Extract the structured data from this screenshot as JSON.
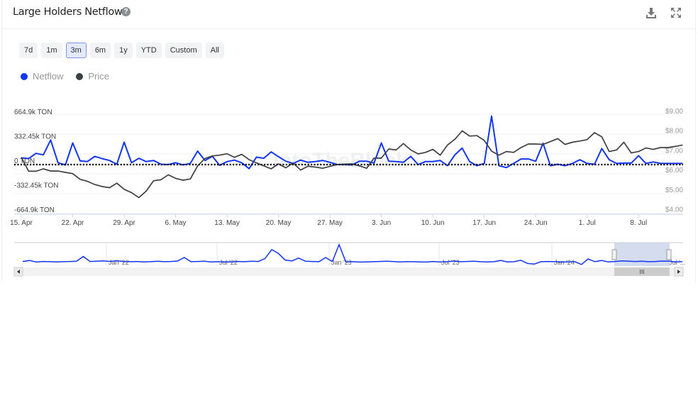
{
  "header": {
    "title": "Large Holders Netflow",
    "help_icon": "question-circle-icon",
    "download_icon": "download-icon",
    "fullscreen_icon": "expand-icon"
  },
  "ranges": [
    {
      "label": "7d"
    },
    {
      "label": "1m"
    },
    {
      "label": "3m",
      "selected": true
    },
    {
      "label": "6m"
    },
    {
      "label": "1y"
    },
    {
      "label": "YTD"
    },
    {
      "label": "Custom"
    },
    {
      "label": "All"
    }
  ],
  "legend": [
    {
      "label": "Netflow",
      "color": "#1336f2"
    },
    {
      "label": "Price",
      "color": "#3d3f42"
    }
  ],
  "watermark": "IntoTheBlock",
  "chart_data": {
    "type": "line",
    "title": "",
    "y_left": {
      "ticks": [
        "664.9k TON",
        "332.45k TON",
        "0 TON",
        "-332.45k TON",
        "-664.9k TON"
      ],
      "range": [
        -664.9,
        664.9
      ],
      "unit": "k TON"
    },
    "y_right": {
      "ticks": [
        "$9.00",
        "$8.00",
        "$7.00",
        "$6.00",
        "$5.00",
        "$4.00"
      ],
      "range": [
        4,
        9
      ]
    },
    "x_ticks": [
      "15. Apr",
      "22. Apr",
      "29. Apr",
      "6. May",
      "13. May",
      "20. May",
      "27. May",
      "3. Jun",
      "10. Jun",
      "17. Jun",
      "24. Jun",
      "1. Jul",
      "8. Jul"
    ],
    "dates": [
      "2024-04-15",
      "2024-04-16",
      "2024-04-17",
      "2024-04-18",
      "2024-04-19",
      "2024-04-20",
      "2024-04-21",
      "2024-04-22",
      "2024-04-23",
      "2024-04-24",
      "2024-04-25",
      "2024-04-26",
      "2024-04-27",
      "2024-04-28",
      "2024-04-29",
      "2024-04-30",
      "2024-05-01",
      "2024-05-02",
      "2024-05-03",
      "2024-05-04",
      "2024-05-05",
      "2024-05-06",
      "2024-05-07",
      "2024-05-08",
      "2024-05-09",
      "2024-05-10",
      "2024-05-11",
      "2024-05-12",
      "2024-05-13",
      "2024-05-14",
      "2024-05-15",
      "2024-05-16",
      "2024-05-17",
      "2024-05-18",
      "2024-05-19",
      "2024-05-20",
      "2024-05-21",
      "2024-05-22",
      "2024-05-23",
      "2024-05-24",
      "2024-05-25",
      "2024-05-26",
      "2024-05-27",
      "2024-05-28",
      "2024-05-29",
      "2024-05-30",
      "2024-05-31",
      "2024-06-01",
      "2024-06-02",
      "2024-06-03",
      "2024-06-04",
      "2024-06-05",
      "2024-06-06",
      "2024-06-07",
      "2024-06-08",
      "2024-06-09",
      "2024-06-10",
      "2024-06-11",
      "2024-06-12",
      "2024-06-13",
      "2024-06-14",
      "2024-06-15",
      "2024-06-16",
      "2024-06-17",
      "2024-06-18",
      "2024-06-19",
      "2024-06-20",
      "2024-06-21",
      "2024-06-22",
      "2024-06-23",
      "2024-06-24",
      "2024-06-25",
      "2024-06-26",
      "2024-06-27",
      "2024-06-28",
      "2024-06-29",
      "2024-06-30",
      "2024-07-01",
      "2024-07-02",
      "2024-07-03",
      "2024-07-04",
      "2024-07-05",
      "2024-07-06",
      "2024-07-07",
      "2024-07-08",
      "2024-07-09",
      "2024-07-10",
      "2024-07-11",
      "2024-07-12",
      "2024-07-13",
      "2024-07-14"
    ],
    "series": [
      {
        "name": "Netflow",
        "axis": "left",
        "color": "#1336f2",
        "values": [
          90,
          80,
          150,
          130,
          330,
          25,
          -5,
          290,
          50,
          40,
          110,
          80,
          55,
          5,
          300,
          25,
          85,
          40,
          55,
          5,
          0,
          25,
          -5,
          15,
          180,
          55,
          110,
          -10,
          40,
          60,
          25,
          -55,
          100,
          85,
          170,
          105,
          45,
          15,
          60,
          30,
          40,
          55,
          30,
          0,
          0,
          -5,
          45,
          45,
          20,
          290,
          45,
          40,
          30,
          110,
          0,
          40,
          40,
          55,
          -15,
          130,
          220,
          40,
          -15,
          15,
          650,
          -15,
          -40,
          15,
          75,
          75,
          45,
          285,
          -15,
          5,
          -15,
          15,
          65,
          15,
          5,
          215,
          65,
          15,
          20,
          20,
          120,
          15,
          35,
          15,
          15,
          15,
          15
        ]
      },
      {
        "name": "Price",
        "axis": "right",
        "color": "#3d3f42",
        "values": [
          6.83,
          6.13,
          6.13,
          6.25,
          6.14,
          6.14,
          6.07,
          6.01,
          5.72,
          5.62,
          5.46,
          5.36,
          5.3,
          5.53,
          5.22,
          5.05,
          4.8,
          5.13,
          5.65,
          5.7,
          5.95,
          5.77,
          5.68,
          5.74,
          6.4,
          6.77,
          6.9,
          6.94,
          7.01,
          6.83,
          6.98,
          6.71,
          6.55,
          6.4,
          6.25,
          6.5,
          6.3,
          6.55,
          6.19,
          6.38,
          6.34,
          6.28,
          6.37,
          6.47,
          6.49,
          6.5,
          6.4,
          6.28,
          6.79,
          6.79,
          7.25,
          7.2,
          7.52,
          7.2,
          7.0,
          7.08,
          7.23,
          6.94,
          7.45,
          7.74,
          8.16,
          7.9,
          7.92,
          7.68,
          7.14,
          6.94,
          7.12,
          7.08,
          7.32,
          7.5,
          7.5,
          7.48,
          7.62,
          7.77,
          7.48,
          7.59,
          7.65,
          7.72,
          8.07,
          7.86,
          7.12,
          7.2,
          7.59,
          7.05,
          7.12,
          7.3,
          7.23,
          7.32,
          7.32,
          7.38,
          7.45
        ]
      }
    ],
    "zero_line": "dotted",
    "legend_position": "top-left",
    "grid": true
  },
  "navigator": {
    "ticks": [
      "Jan '22",
      "Jul '22",
      "Jan '23",
      "Jul '23",
      "Jan '24",
      "Jul '..."
    ],
    "values": [
      5,
      10,
      2,
      5,
      4,
      3,
      4,
      5,
      6,
      30,
      5,
      6,
      8,
      5,
      9,
      4,
      4,
      5,
      3,
      4,
      6,
      4,
      5,
      7,
      25,
      4,
      5,
      6,
      3,
      4,
      3,
      3,
      5,
      4,
      6,
      5,
      20,
      65,
      45,
      12,
      8,
      22,
      6,
      5,
      4,
      25,
      5,
      90,
      3,
      4,
      2,
      3,
      4,
      5,
      6,
      5,
      3,
      4,
      4,
      3,
      2,
      5,
      3,
      4,
      7,
      4,
      5,
      6,
      4,
      3,
      4,
      10,
      3,
      4,
      11,
      -5,
      -8,
      4,
      5,
      4,
      3,
      3,
      4,
      -10,
      18,
      4,
      10,
      3,
      5,
      8,
      6,
      5,
      6,
      4,
      5,
      7,
      6,
      3,
      4
    ],
    "selected_range": "3m"
  }
}
